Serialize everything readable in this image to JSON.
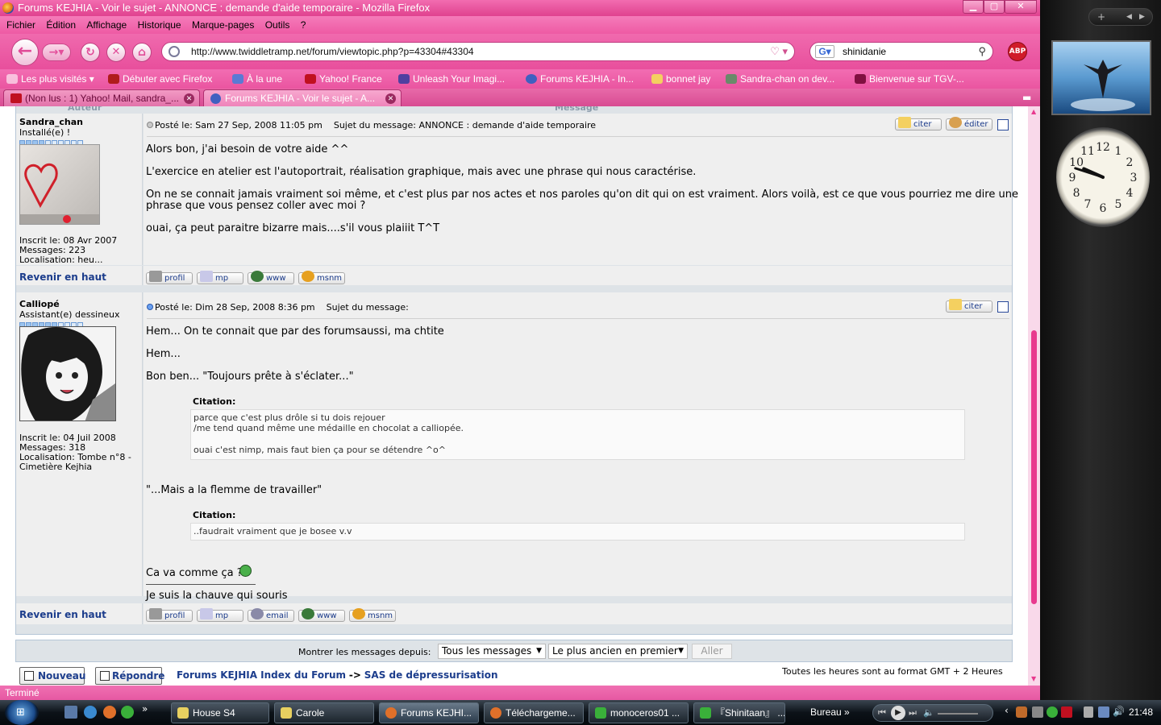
{
  "window": {
    "title": "Forums KEJHIA - Voir le sujet - ANNONCE : demande d'aide temporaire - Mozilla Firefox"
  },
  "menu": [
    "Fichier",
    "Édition",
    "Affichage",
    "Historique",
    "Marque-pages",
    "Outils",
    "?"
  ],
  "nav": {
    "url": "http://www.twiddletramp.net/forum/viewtopic.php?p=43304#43304",
    "search_value": "shinidanie",
    "abp": "ABP"
  },
  "bookmarks": [
    "Les plus visités",
    "Débuter avec Firefox",
    "À la une",
    "Yahoo! France",
    "Unleash Your Imagi...",
    "Forums KEJHIA - In...",
    "bonnet jay",
    "Sandra-chan on dev...",
    "Bienvenue sur TGV-..."
  ],
  "tabs": [
    "(Non lus : 1) Yahoo! Mail, sandra_...",
    "Forums KEJHIA - Voir le sujet - A..."
  ],
  "forum": {
    "col_author": "Auteur",
    "col_message": "Message",
    "back_top": "Revenir en haut",
    "posts": [
      {
        "author": "Sandra_chan",
        "rank": "Installé(e) !",
        "rank_filled": 4,
        "joined": "Inscrit le: 08 Avr 2007",
        "messages": "Messages: 223",
        "location": "Localisation: heu...",
        "meta": "Posté le: Sam 27 Sep, 2008 11:05 pm    Sujet du message: ANNONCE : demande d'aide temporaire",
        "btn_quote": "citer",
        "btn_edit": "éditer",
        "lines": [
          "Alors bon, j'ai besoin de votre aide ^^",
          "L'exercice en atelier est l'autoportrait, réalisation graphique, mais avec une phrase qui nous caractérise.",
          "On ne se connait jamais vraiment soi même, et c'est plus par nos actes et nos paroles qu'on dit qui on est vraiment. Alors voilà, est ce que vous pourriez me dire une",
          "phrase que vous pensez coller avec moi ?",
          "ouai, ça peut paraitre bizarre mais....s'il vous plaiiit T^T"
        ],
        "footer_btns": [
          "profil",
          "mp",
          "www",
          "msnm"
        ]
      },
      {
        "author": "Calliopé",
        "rank": "Assistant(e) dessineux",
        "rank_filled": 6,
        "joined": "Inscrit le: 04 Juil 2008",
        "messages": "Messages: 318",
        "location1": "Localisation: Tombe n°8 -",
        "location2": "Cimetière Kejhia",
        "meta": "Posté le: Dim 28 Sep, 2008 8:36 pm    Sujet du message:",
        "btn_quote": "citer",
        "l1": "Hem... On te connait que par des forumsaussi, ma chtite",
        "l2": "Hem...",
        "l3": "Bon ben... \"Toujours prête à s'éclater...\"",
        "quote_label": "Citation:",
        "q1a": "parce que c'est plus drôle si tu dois rejouer",
        "q1b": "/me tend quand même une médaille en chocolat a calliopée.",
        "q1c": "ouai c'est nimp, mais faut bien ça pour se détendre ^o^",
        "l4": "\"...Mais a la flemme de travailler\"",
        "q2": "..faudrait vraiment que je bosee v.v",
        "l5": "Ca va comme ça ?",
        "sig": "Je suis la chauve qui souris",
        "footer_btns": [
          "profil",
          "mp",
          "email",
          "www",
          "msnm"
        ]
      }
    ],
    "show_from_label": "Montrer les messages depuis:",
    "show_select": "Tous les messages",
    "order_select": "Le plus ancien en premier",
    "go": "Aller",
    "btn_new": "Nouveau",
    "btn_reply": "Répondre",
    "crumb_index": "Forums KEJHIA Index du Forum",
    "crumb_sep": "->",
    "crumb_forum": "SAS de dépressurisation",
    "timezone": "Toutes les heures sont au format GMT + 2 Heures"
  },
  "status": "Terminé",
  "taskbar": {
    "items": [
      "House S4",
      "Carole",
      "Forums KEJHI...",
      "Téléchargeme...",
      "monoceros01 ...",
      "『Shinitaan』 ...",
      "Bureau"
    ],
    "clock": "21:48"
  },
  "sidebar_clock": [
    "12",
    "1",
    "2",
    "3",
    "4",
    "5",
    "6",
    "7",
    "8",
    "9",
    "10",
    "11"
  ]
}
